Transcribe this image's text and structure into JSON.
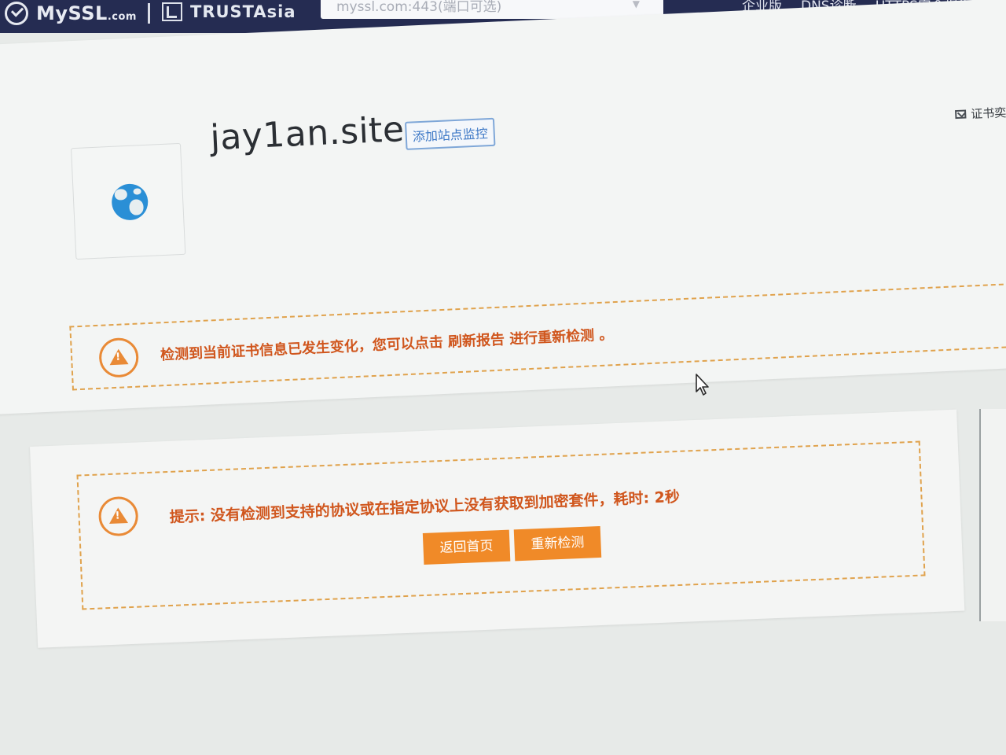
{
  "header": {
    "logo_text": "MySSL",
    "logo_suffix": ".com",
    "partner_text": "TRUSTAsia",
    "url_text": "myssl.com:443(端口可选)",
    "nav": [
      "企业版",
      "DNS诊断",
      "HTTPS安全报告",
      "上"
    ]
  },
  "site": {
    "domain": "jay1an.site",
    "add_monitor_label": "添加站点监控",
    "cert_link_label": "证书奕"
  },
  "alerts": {
    "changed_msg": "检测到当前证书信息已发生变化，您可以点击 刷新报告 进行重新检测 。",
    "hint_msg": "提示: 没有检测到支持的协议或在指定协议上没有获取到加密套件，耗时: 2秒"
  },
  "actions": {
    "home_label": "返回首页",
    "retest_label": "重新检测"
  },
  "colors": {
    "nav_bg": "#252c52",
    "warning": "#d0561d",
    "button": "#f08a28",
    "link": "#3d78c6"
  },
  "icons": [
    "myssl-logo-icon",
    "trustasia-logo-icon",
    "dropdown-arrow-icon",
    "globe-icon",
    "mail-icon",
    "warning-icon",
    "mouse-cursor-icon"
  ]
}
